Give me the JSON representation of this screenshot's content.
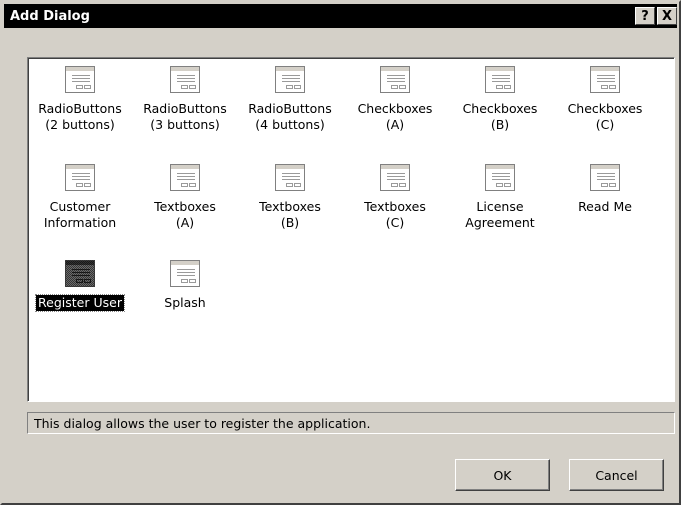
{
  "window": {
    "title": "Add Dialog",
    "help_glyph": "?",
    "close_glyph": "X"
  },
  "items": [
    {
      "label": "RadioButtons\n(2 buttons)",
      "icon": "dialog-icon",
      "selected": false
    },
    {
      "label": "RadioButtons\n(3 buttons)",
      "icon": "dialog-icon",
      "selected": false
    },
    {
      "label": "RadioButtons\n(4 buttons)",
      "icon": "dialog-icon",
      "selected": false
    },
    {
      "label": "Checkboxes\n(A)",
      "icon": "dialog-icon",
      "selected": false
    },
    {
      "label": "Checkboxes\n(B)",
      "icon": "dialog-icon",
      "selected": false
    },
    {
      "label": "Checkboxes\n(C)",
      "icon": "dialog-icon",
      "selected": false
    },
    {
      "label": "Customer\nInformation",
      "icon": "dialog-icon",
      "selected": false
    },
    {
      "label": "Textboxes\n(A)",
      "icon": "dialog-icon",
      "selected": false
    },
    {
      "label": "Textboxes\n(B)",
      "icon": "dialog-icon",
      "selected": false
    },
    {
      "label": "Textboxes\n(C)",
      "icon": "dialog-icon",
      "selected": false
    },
    {
      "label": "License\nAgreement",
      "icon": "dialog-icon",
      "selected": false
    },
    {
      "label": "Read Me",
      "icon": "dialog-icon",
      "selected": false
    },
    {
      "label": "Register User",
      "icon": "dialog-icon",
      "selected": true
    },
    {
      "label": "Splash",
      "icon": "dialog-icon",
      "selected": false
    }
  ],
  "status": {
    "text": "This dialog allows the user to register the application."
  },
  "buttons": {
    "ok": "OK",
    "cancel": "Cancel"
  }
}
